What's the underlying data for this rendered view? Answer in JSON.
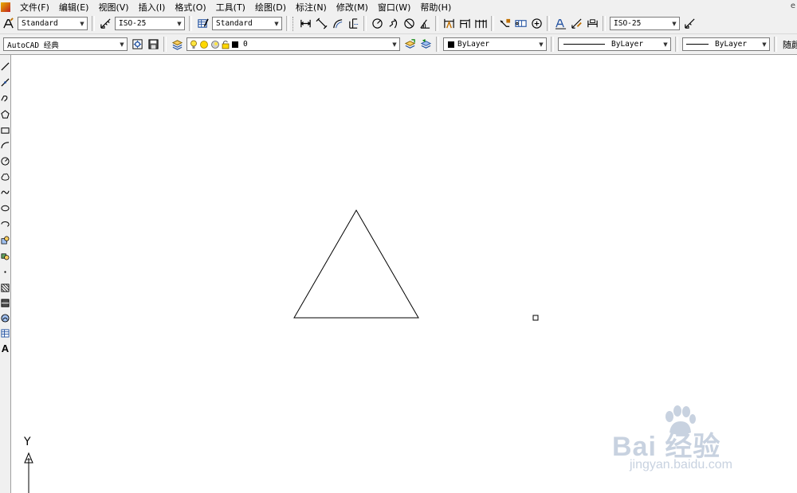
{
  "menubar": {
    "items": [
      "文件(F)",
      "编辑(E)",
      "视图(V)",
      "插入(I)",
      "格式(O)",
      "工具(T)",
      "绘图(D)",
      "标注(N)",
      "修改(M)",
      "窗口(W)",
      "帮助(H)"
    ],
    "corner_glyph": "e"
  },
  "styles_toolbar": {
    "text_style": "Standard",
    "dim_style": "ISO-25",
    "table_style": "Standard",
    "dim_style_right": "ISO-25"
  },
  "workspace_toolbar": {
    "workspace": "AutoCAD 经典",
    "layer_name": "0",
    "color": "ByLayer",
    "linetype": "ByLayer",
    "lineweight": "ByLayer",
    "plot_style_partial": "随颜色"
  },
  "canvas": {
    "ucs_y_label": "Y",
    "background": "#ffffff",
    "line_color": "#000000"
  },
  "watermark": {
    "main": "Bai 经验",
    "sub": "jingyan.baidu.com"
  }
}
